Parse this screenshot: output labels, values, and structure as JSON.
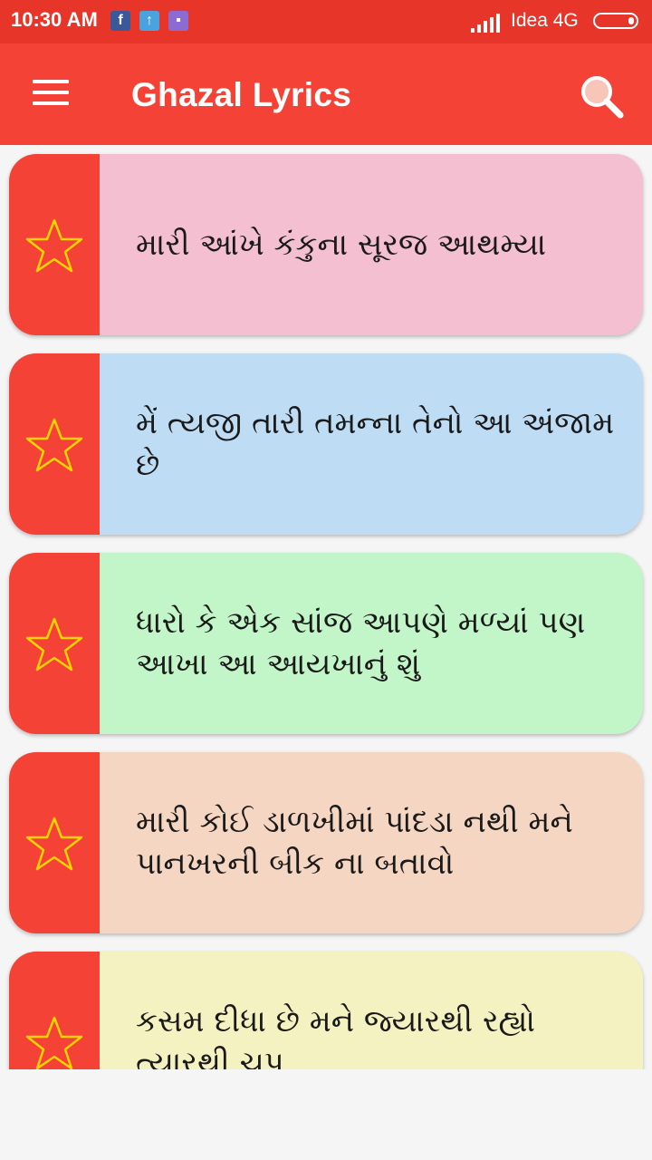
{
  "status_bar": {
    "time": "10:30 AM",
    "carrier": "Idea 4G",
    "notifications": [
      "facebook-icon",
      "upload-icon",
      "messenger-icon"
    ]
  },
  "app_bar": {
    "title": "Ghazal Lyrics",
    "menu_icon": "hamburger-menu-icon",
    "search_icon": "search-icon"
  },
  "colors": {
    "status_bar": "#e8352a",
    "app_bar": "#f44336",
    "card_accent": "#f44336",
    "star_outline": "#ffd400"
  },
  "ghazals": [
    {
      "title": "મારી આંખે કંકુના સૂરજ આથમ્યા",
      "bg": "#f5bfd2"
    },
    {
      "title": "મેં ત્યજી તારી તમન્ના તેનો આ અંજામ છે",
      "bg": "#bfdcf5"
    },
    {
      "title": "ધારો કે એક સાંજ આપણે મળ્યાં પણ આખા આ આયખાનું શું",
      "bg": "#c2f5c7"
    },
    {
      "title": "મારી કોઈ ડાળખીમાં પાંદડા નથી મને પાનખરની બીક ના બતાવો",
      "bg": "#f5d6c2"
    },
    {
      "title": "કસમ દીધા છે મને જ્યારથી રહ્યો ત્યારથી ચુપ",
      "bg": "#f5f2c2"
    }
  ]
}
